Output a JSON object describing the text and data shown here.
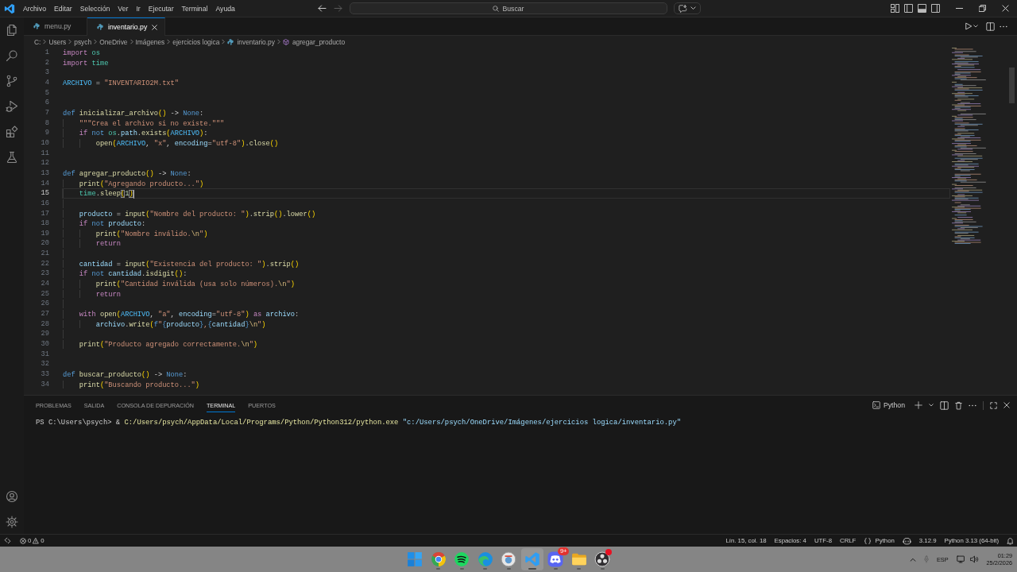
{
  "title_bar": {
    "menu": [
      "Archivo",
      "Editar",
      "Selección",
      "Ver",
      "Ir",
      "Ejecutar",
      "Terminal",
      "Ayuda"
    ],
    "nav_buttons": [
      {
        "kind": "back",
        "disabled": false
      },
      {
        "kind": "forward",
        "disabled": true
      }
    ],
    "command_center": {
      "label": "Buscar"
    },
    "layout_toggles": [
      {
        "kind": "primary_sidebar",
        "on": false
      },
      {
        "kind": "panel",
        "on": true
      },
      {
        "kind": "secondary_sidebar",
        "on": false
      }
    ]
  },
  "editor_tabs": [
    {
      "label": "menu.py",
      "selected": false
    },
    {
      "label": "inventario.py",
      "selected": true
    }
  ],
  "breadcrumb": [
    {
      "kind": "folder",
      "label": "C:"
    },
    {
      "kind": "folder",
      "label": "Users"
    },
    {
      "kind": "folder",
      "label": "psych"
    },
    {
      "kind": "folder",
      "label": "OneDrive"
    },
    {
      "kind": "folder",
      "label": "Imágenes"
    },
    {
      "kind": "folder",
      "label": "ejercicios logica"
    },
    {
      "kind": "file",
      "label": "inventario.py"
    },
    {
      "kind": "symbol",
      "label": "agregar_producto"
    }
  ],
  "editor": {
    "lines": [
      {
        "number": "1",
        "current": false,
        "tokens": [
          {
            "kind": "control",
            "text": "import "
          },
          {
            "kind": "module",
            "text": "os"
          }
        ]
      },
      {
        "number": "2",
        "current": false,
        "tokens": [
          {
            "kind": "control",
            "text": "import "
          },
          {
            "kind": "module",
            "text": "time"
          }
        ]
      },
      {
        "number": "3",
        "current": false
      },
      {
        "number": "4",
        "current": false,
        "tokens": [
          {
            "kind": "constant",
            "text": "ARCHIVO"
          },
          {
            "kind": "plain",
            "text": " = "
          },
          {
            "kind": "string",
            "text": "\"INVENTARIO2M.txt\""
          }
        ]
      },
      {
        "number": "5",
        "current": false
      },
      {
        "number": "6",
        "current": false
      },
      {
        "number": "7",
        "current": false,
        "tokens": [
          {
            "kind": "keyword",
            "text": "def "
          },
          {
            "kind": "function",
            "text": "inicializar_archivo"
          },
          {
            "kind": "bracket",
            "text": "()"
          },
          {
            "kind": "plain",
            "text": " -> "
          },
          {
            "kind": "keyword",
            "text": "None"
          },
          {
            "kind": "plain",
            "text": ":"
          }
        ],
        "children": [
          {
            "number": "8",
            "current": false,
            "tokens": [
              {
                "kind": "string",
                "text": "\"\"\"Crea el archivo si no existe.\"\"\""
              }
            ]
          },
          {
            "number": "9",
            "current": false,
            "tokens": [
              {
                "kind": "control",
                "text": "if "
              },
              {
                "kind": "keyword",
                "text": "not "
              },
              {
                "kind": "module",
                "text": "os"
              },
              {
                "kind": "plain",
                "text": "."
              },
              {
                "kind": "variable",
                "text": "path"
              },
              {
                "kind": "plain",
                "text": "."
              },
              {
                "kind": "function",
                "text": "exists"
              },
              {
                "kind": "bracket",
                "text": "("
              },
              {
                "kind": "constant",
                "text": "ARCHIVO"
              },
              {
                "kind": "bracket",
                "text": ")"
              },
              {
                "kind": "plain",
                "text": ":"
              }
            ],
            "children": [
              {
                "number": "10",
                "current": false,
                "tokens": [
                  {
                    "kind": "function",
                    "text": "open"
                  },
                  {
                    "kind": "bracket",
                    "text": "("
                  },
                  {
                    "kind": "constant",
                    "text": "ARCHIVO"
                  },
                  {
                    "kind": "plain",
                    "text": ", "
                  },
                  {
                    "kind": "string",
                    "text": "\"x\""
                  },
                  {
                    "kind": "plain",
                    "text": ", "
                  },
                  {
                    "kind": "variable",
                    "text": "encoding"
                  },
                  {
                    "kind": "plain",
                    "text": "="
                  },
                  {
                    "kind": "string",
                    "text": "\"utf-8\""
                  },
                  {
                    "kind": "bracket",
                    "text": ")"
                  },
                  {
                    "kind": "plain",
                    "text": "."
                  },
                  {
                    "kind": "function",
                    "text": "close"
                  },
                  {
                    "kind": "bracket",
                    "text": "()"
                  }
                ]
              }
            ]
          }
        ]
      },
      {
        "number": "11",
        "current": false
      },
      {
        "number": "12",
        "current": false
      },
      {
        "number": "13",
        "current": false,
        "tokens": [
          {
            "kind": "keyword",
            "text": "def "
          },
          {
            "kind": "function",
            "text": "agregar_producto"
          },
          {
            "kind": "bracket",
            "text": "()"
          },
          {
            "kind": "plain",
            "text": " -> "
          },
          {
            "kind": "keyword",
            "text": "None"
          },
          {
            "kind": "plain",
            "text": ":"
          }
        ],
        "children": [
          {
            "number": "14",
            "current": false,
            "tokens": [
              {
                "kind": "function",
                "text": "print"
              },
              {
                "kind": "bracket",
                "text": "("
              },
              {
                "kind": "string",
                "text": "\"Agregando producto...\""
              },
              {
                "kind": "bracket",
                "text": ")"
              }
            ]
          },
          {
            "number": "15",
            "current": true,
            "tokens": [
              {
                "kind": "module",
                "text": "time"
              },
              {
                "kind": "plain",
                "text": "."
              },
              {
                "kind": "function",
                "text": "sleep"
              },
              {
                "kind": "matched-bracket",
                "text": "("
              },
              {
                "kind": "number",
                "text": "1"
              },
              {
                "kind": "matched-bracket",
                "text": ")"
              }
            ]
          },
          {
            "number": "16",
            "current": false
          },
          {
            "number": "17",
            "current": false,
            "tokens": [
              {
                "kind": "variable",
                "text": "producto"
              },
              {
                "kind": "plain",
                "text": " = "
              },
              {
                "kind": "function",
                "text": "input"
              },
              {
                "kind": "bracket",
                "text": "("
              },
              {
                "kind": "string",
                "text": "\"Nombre del producto: \""
              },
              {
                "kind": "bracket",
                "text": ")"
              },
              {
                "kind": "plain",
                "text": "."
              },
              {
                "kind": "function",
                "text": "strip"
              },
              {
                "kind": "bracket",
                "text": "()"
              },
              {
                "kind": "plain",
                "text": "."
              },
              {
                "kind": "function",
                "text": "lower"
              },
              {
                "kind": "bracket",
                "text": "()"
              }
            ]
          },
          {
            "number": "18",
            "current": false,
            "tokens": [
              {
                "kind": "control",
                "text": "if "
              },
              {
                "kind": "keyword",
                "text": "not "
              },
              {
                "kind": "variable",
                "text": "producto"
              },
              {
                "kind": "plain",
                "text": ":"
              }
            ],
            "children": [
              {
                "number": "19",
                "current": false,
                "tokens": [
                  {
                    "kind": "function",
                    "text": "print"
                  },
                  {
                    "kind": "bracket",
                    "text": "("
                  },
                  {
                    "kind": "string",
                    "text": "\"Nombre inválido."
                  },
                  {
                    "kind": "escape",
                    "text": "\\n"
                  },
                  {
                    "kind": "string",
                    "text": "\""
                  },
                  {
                    "kind": "bracket",
                    "text": ")"
                  }
                ]
              },
              {
                "number": "20",
                "current": false,
                "tokens": [
                  {
                    "kind": "control",
                    "text": "return"
                  }
                ]
              }
            ]
          },
          {
            "number": "21",
            "current": false
          },
          {
            "number": "22",
            "current": false,
            "tokens": [
              {
                "kind": "variable",
                "text": "cantidad"
              },
              {
                "kind": "plain",
                "text": " = "
              },
              {
                "kind": "function",
                "text": "input"
              },
              {
                "kind": "bracket",
                "text": "("
              },
              {
                "kind": "string",
                "text": "\"Existencia del producto: \""
              },
              {
                "kind": "bracket",
                "text": ")"
              },
              {
                "kind": "plain",
                "text": "."
              },
              {
                "kind": "function",
                "text": "strip"
              },
              {
                "kind": "bracket",
                "text": "()"
              }
            ]
          },
          {
            "number": "23",
            "current": false,
            "tokens": [
              {
                "kind": "control",
                "text": "if "
              },
              {
                "kind": "keyword",
                "text": "not "
              },
              {
                "kind": "variable",
                "text": "cantidad"
              },
              {
                "kind": "plain",
                "text": "."
              },
              {
                "kind": "function",
                "text": "isdigit"
              },
              {
                "kind": "bracket",
                "text": "()"
              },
              {
                "kind": "plain",
                "text": ":"
              }
            ],
            "children": [
              {
                "number": "24",
                "current": false,
                "tokens": [
                  {
                    "kind": "function",
                    "text": "print"
                  },
                  {
                    "kind": "bracket",
                    "text": "("
                  },
                  {
                    "kind": "string",
                    "text": "\"Cantidad inválida (usa solo números)."
                  },
                  {
                    "kind": "escape",
                    "text": "\\n"
                  },
                  {
                    "kind": "string",
                    "text": "\""
                  },
                  {
                    "kind": "bracket",
                    "text": ")"
                  }
                ]
              },
              {
                "number": "25",
                "current": false,
                "tokens": [
                  {
                    "kind": "control",
                    "text": "return"
                  }
                ]
              }
            ]
          },
          {
            "number": "26",
            "current": false
          },
          {
            "number": "27",
            "current": false,
            "tokens": [
              {
                "kind": "control",
                "text": "with "
              },
              {
                "kind": "function",
                "text": "open"
              },
              {
                "kind": "bracket",
                "text": "("
              },
              {
                "kind": "constant",
                "text": "ARCHIVO"
              },
              {
                "kind": "plain",
                "text": ", "
              },
              {
                "kind": "string",
                "text": "\"a\""
              },
              {
                "kind": "plain",
                "text": ", "
              },
              {
                "kind": "variable",
                "text": "encoding"
              },
              {
                "kind": "plain",
                "text": "="
              },
              {
                "kind": "string",
                "text": "\"utf-8\""
              },
              {
                "kind": "bracket",
                "text": ")"
              },
              {
                "kind": "control",
                "text": " as "
              },
              {
                "kind": "variable",
                "text": "archivo"
              },
              {
                "kind": "plain",
                "text": ":"
              }
            ],
            "children": [
              {
                "number": "28",
                "current": false,
                "tokens": [
                  {
                    "kind": "variable",
                    "text": "archivo"
                  },
                  {
                    "kind": "plain",
                    "text": "."
                  },
                  {
                    "kind": "function",
                    "text": "write"
                  },
                  {
                    "kind": "bracket",
                    "text": "("
                  },
                  {
                    "kind": "keyword",
                    "text": "f"
                  },
                  {
                    "kind": "string",
                    "text": "\""
                  },
                  {
                    "kind": "keyword",
                    "text": "{"
                  },
                  {
                    "kind": "variable",
                    "text": "producto"
                  },
                  {
                    "kind": "keyword",
                    "text": "}"
                  },
                  {
                    "kind": "string",
                    "text": ","
                  },
                  {
                    "kind": "keyword",
                    "text": "{"
                  },
                  {
                    "kind": "variable",
                    "text": "cantidad"
                  },
                  {
                    "kind": "keyword",
                    "text": "}"
                  },
                  {
                    "kind": "escape",
                    "text": "\\n"
                  },
                  {
                    "kind": "string",
                    "text": "\""
                  },
                  {
                    "kind": "bracket",
                    "text": ")"
                  }
                ]
              }
            ]
          },
          {
            "number": "29",
            "current": false
          },
          {
            "number": "30",
            "current": false,
            "tokens": [
              {
                "kind": "function",
                "text": "print"
              },
              {
                "kind": "bracket",
                "text": "("
              },
              {
                "kind": "string",
                "text": "\"Producto agregado correctamente."
              },
              {
                "kind": "escape",
                "text": "\\n"
              },
              {
                "kind": "string",
                "text": "\""
              },
              {
                "kind": "bracket",
                "text": ")"
              }
            ]
          }
        ]
      },
      {
        "number": "31",
        "current": false
      },
      {
        "number": "32",
        "current": false
      },
      {
        "number": "33",
        "current": false,
        "tokens": [
          {
            "kind": "keyword",
            "text": "def "
          },
          {
            "kind": "function",
            "text": "buscar_producto"
          },
          {
            "kind": "bracket",
            "text": "()"
          },
          {
            "kind": "plain",
            "text": " -> "
          },
          {
            "kind": "keyword",
            "text": "None"
          },
          {
            "kind": "plain",
            "text": ":"
          }
        ],
        "children": [
          {
            "number": "34",
            "current": false,
            "tokens": [
              {
                "kind": "function",
                "text": "print"
              },
              {
                "kind": "bracket",
                "text": "("
              },
              {
                "kind": "string",
                "text": "\"Buscando producto...\""
              },
              {
                "kind": "bracket",
                "text": ")"
              }
            ]
          }
        ]
      }
    ]
  },
  "panel": {
    "tabs": [
      {
        "label": "PROBLEMAS",
        "selected": false
      },
      {
        "label": "SALIDA",
        "selected": false
      },
      {
        "label": "CONSOLA DE DEPURACIÓN",
        "selected": false
      },
      {
        "label": "TERMINAL",
        "selected": true
      },
      {
        "label": "PUERTOS",
        "selected": false
      }
    ],
    "terminal_profile": "Python",
    "terminal": {
      "lines": [
        {
          "tokens": [
            {
              "kind": "prompt",
              "text": "PS C:\\Users\\psych> "
            },
            {
              "kind": "operator",
              "text": "& "
            },
            {
              "kind": "command",
              "text": "C:/Users/psych/AppData/Local/Programs/Python/Python312/python.exe "
            },
            {
              "kind": "argument",
              "text": "\"c:/Users/psych/OneDrive/Imágenes/ejercicios logica/inventario.py\""
            }
          ]
        }
      ]
    }
  },
  "status_bar": {
    "errors": "0",
    "warnings": "0",
    "items": [
      {
        "kind": "text",
        "label": "Lín. 15, col. 18"
      },
      {
        "kind": "text",
        "label": "Espacios: 4"
      },
      {
        "kind": "text",
        "label": "UTF-8"
      },
      {
        "kind": "text",
        "label": "CRLF"
      },
      {
        "kind": "language",
        "label": "Python"
      },
      {
        "kind": "assistant"
      },
      {
        "kind": "text",
        "label": "3.12.9"
      },
      {
        "kind": "text",
        "label": "Python 3.13 (64-bit)"
      },
      {
        "kind": "notifications"
      }
    ]
  },
  "taskbar": {
    "apps": [
      {
        "kind": "start",
        "running": false,
        "selected": false,
        "alert": false
      },
      {
        "kind": "browser",
        "running": true,
        "selected": false,
        "alert": false
      },
      {
        "kind": "music",
        "running": true,
        "selected": false,
        "alert": false
      },
      {
        "kind": "web",
        "running": true,
        "selected": false,
        "alert": false
      },
      {
        "kind": "photos",
        "running": true,
        "selected": false,
        "alert": false
      },
      {
        "kind": "code",
        "running": true,
        "selected": true,
        "alert": false
      },
      {
        "kind": "chat",
        "running": true,
        "selected": false,
        "alert": false,
        "badge": "9+"
      },
      {
        "kind": "files",
        "running": true,
        "selected": false,
        "alert": false
      },
      {
        "kind": "recorder",
        "running": true,
        "selected": false,
        "alert": true
      }
    ],
    "tray": {
      "language": "ESP",
      "time": "01:29",
      "date": "25/2/2026"
    }
  }
}
